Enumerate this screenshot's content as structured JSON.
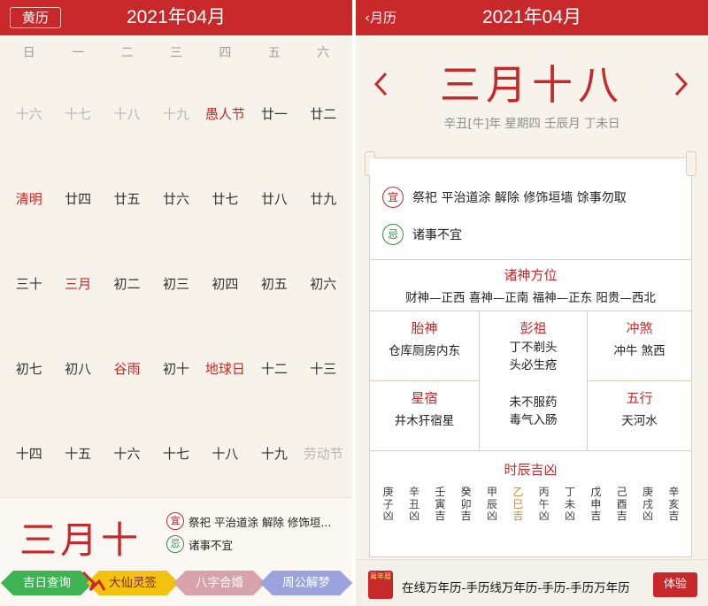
{
  "left": {
    "header": {
      "button_label": "黄历",
      "title": "2021年04月"
    },
    "weekdays": [
      "日",
      "一",
      "二",
      "三",
      "四",
      "五",
      "六"
    ],
    "days": [
      {
        "text": "十六",
        "style": "gray"
      },
      {
        "text": "十七",
        "style": "gray"
      },
      {
        "text": "十八",
        "style": "gray"
      },
      {
        "text": "十九",
        "style": "gray"
      },
      {
        "text": "愚人节",
        "style": "red"
      },
      {
        "text": "廿一",
        "style": "normal"
      },
      {
        "text": "廿二",
        "style": "normal"
      },
      {
        "text": "清明",
        "style": "red"
      },
      {
        "text": "廿四",
        "style": "normal"
      },
      {
        "text": "廿五",
        "style": "normal"
      },
      {
        "text": "廿六",
        "style": "normal"
      },
      {
        "text": "廿七",
        "style": "normal"
      },
      {
        "text": "廿八",
        "style": "normal"
      },
      {
        "text": "廿九",
        "style": "normal"
      },
      {
        "text": "三十",
        "style": "normal"
      },
      {
        "text": "三月",
        "style": "red"
      },
      {
        "text": "初二",
        "style": "normal"
      },
      {
        "text": "初三",
        "style": "normal"
      },
      {
        "text": "初四",
        "style": "normal"
      },
      {
        "text": "初五",
        "style": "normal"
      },
      {
        "text": "初六",
        "style": "normal"
      },
      {
        "text": "初七",
        "style": "normal"
      },
      {
        "text": "初八",
        "style": "normal"
      },
      {
        "text": "谷雨",
        "style": "red"
      },
      {
        "text": "初十",
        "style": "normal"
      },
      {
        "text": "地球日",
        "style": "red"
      },
      {
        "text": "十二",
        "style": "normal"
      },
      {
        "text": "十三",
        "style": "normal"
      },
      {
        "text": "十四",
        "style": "normal"
      },
      {
        "text": "十五",
        "style": "normal"
      },
      {
        "text": "十六",
        "style": "normal"
      },
      {
        "text": "十七",
        "style": "normal"
      },
      {
        "text": "十八",
        "style": "normal"
      },
      {
        "text": "十九",
        "style": "normal"
      },
      {
        "text": "劳动节",
        "style": "gray"
      }
    ],
    "selected": {
      "big_date": "三月十",
      "yi_seal": "宜",
      "yi_text": "祭祀 平治道涂 解除 修饰垣...",
      "ji_seal": "忌",
      "ji_text": "诸事不宜"
    },
    "buttons": [
      "吉日查询",
      "大仙灵签",
      "八字合婚",
      "周公解梦"
    ]
  },
  "right": {
    "header": {
      "back_label": "‹月历",
      "title": "2021年04月"
    },
    "lunar_big": "三月十八",
    "ganzhi": "辛丑[牛]年 星期四 壬辰月 丁未日",
    "yi_seal": "宜",
    "yi_text": "祭祀 平治道涂 解除 修饰垣墙 馀事勿取",
    "ji_seal": "忌",
    "ji_text": "诸事不宜",
    "zhushen": {
      "title": "诸神方位",
      "body": "财神—正西 喜神—正南 福神—正东 阳贵—西北"
    },
    "taishen": {
      "title": "胎神",
      "body": "仓库厕房内东"
    },
    "pengzu": {
      "title": "彭祖",
      "body1": "丁不剃头",
      "body2": "头必生疮",
      "body3": "未不服药",
      "body4": "毒气入肠"
    },
    "chongsha": {
      "title": "冲煞",
      "body": "冲牛 煞西"
    },
    "xingxiu": {
      "title": "星宿",
      "body": "井木犴宿星"
    },
    "wuxing": {
      "title": "五行",
      "body": "天河水"
    },
    "hours_title": "时辰吉凶",
    "hours": [
      {
        "gz1": "庚",
        "gz2": "子",
        "luck": "凶",
        "tone": "bad"
      },
      {
        "gz1": "辛",
        "gz2": "丑",
        "luck": "凶",
        "tone": "bad"
      },
      {
        "gz1": "壬",
        "gz2": "寅",
        "luck": "吉",
        "tone": "good"
      },
      {
        "gz1": "癸",
        "gz2": "卯",
        "luck": "吉",
        "tone": "good"
      },
      {
        "gz1": "甲",
        "gz2": "辰",
        "luck": "凶",
        "tone": "bad"
      },
      {
        "gz1": "乙",
        "gz2": "巳",
        "luck": "吉",
        "tone": "hl"
      },
      {
        "gz1": "丙",
        "gz2": "午",
        "luck": "凶",
        "tone": "bad"
      },
      {
        "gz1": "丁",
        "gz2": "未",
        "luck": "凶",
        "tone": "bad"
      },
      {
        "gz1": "戊",
        "gz2": "申",
        "luck": "吉",
        "tone": "good"
      },
      {
        "gz1": "己",
        "gz2": "酉",
        "luck": "吉",
        "tone": "good"
      },
      {
        "gz1": "庚",
        "gz2": "戌",
        "luck": "凶",
        "tone": "bad"
      },
      {
        "gz1": "辛",
        "gz2": "亥",
        "luck": "吉",
        "tone": "good"
      }
    ],
    "ad": {
      "icon_text": "萬年曆",
      "text": "在线万年历-手历线万年历-手历-手历万年历",
      "button": "体验"
    }
  },
  "colors": {
    "brand_red": "#c8282a",
    "ji_green": "#2f8f3c",
    "bg": "#f7f2ea",
    "gold": "#c9892a"
  }
}
